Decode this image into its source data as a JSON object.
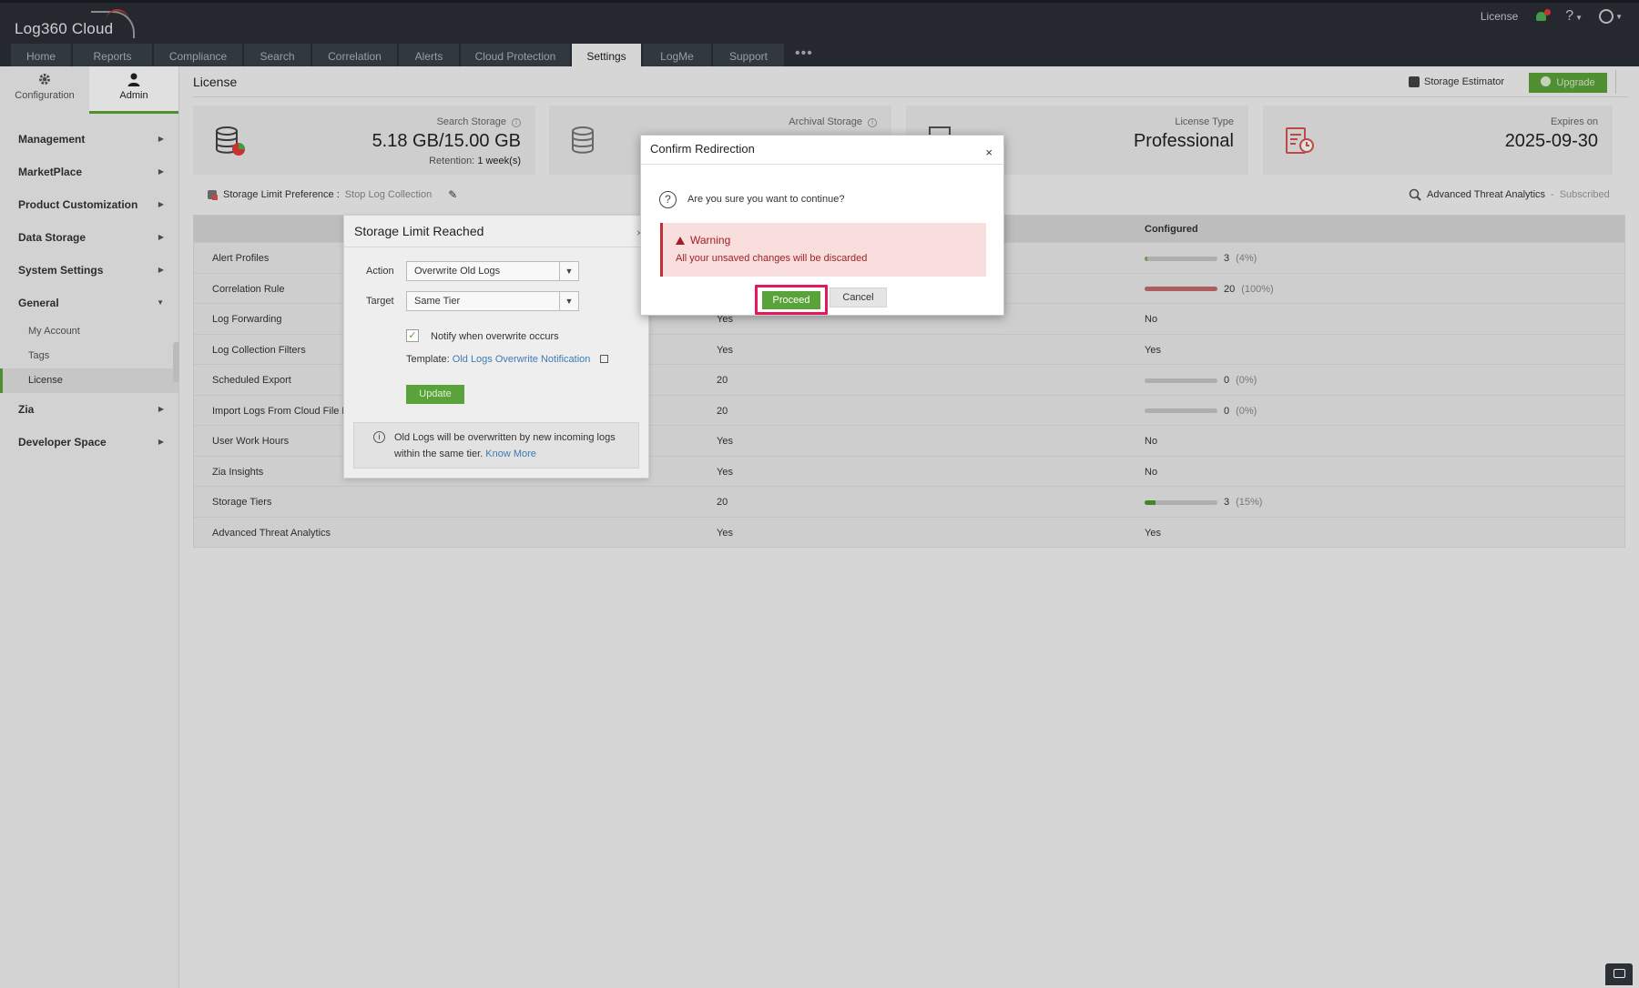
{
  "app": {
    "brand": "Log360 Cloud",
    "top_right": {
      "license_link": "License"
    }
  },
  "nav": {
    "tabs": [
      "Home",
      "Reports",
      "Compliance",
      "Search",
      "Correlation",
      "Alerts",
      "Cloud Protection",
      "Settings",
      "LogMe",
      "Support"
    ],
    "active_tab": "Settings",
    "more": "•••"
  },
  "sidebar": {
    "switch": [
      {
        "label": "Configuration",
        "icon": "gear-icon"
      },
      {
        "label": "Admin",
        "icon": "user-icon",
        "active": true
      }
    ],
    "items": [
      {
        "label": "Management"
      },
      {
        "label": "MarketPlace"
      },
      {
        "label": "Product Customization"
      },
      {
        "label": "Data Storage"
      },
      {
        "label": "System Settings"
      },
      {
        "label": "General",
        "expanded": true
      },
      {
        "label": "Zia"
      },
      {
        "label": "Developer Space"
      }
    ],
    "general_sub": [
      "My Account",
      "Tags",
      "License"
    ],
    "active_sub": "License"
  },
  "main": {
    "title": "License",
    "storage_estimator": "Storage Estimator",
    "upgrade": "Upgrade",
    "cards": {
      "search_storage": {
        "label": "Search Storage",
        "value": "5.18 GB/15.00 GB",
        "retention_label": "Retention:",
        "retention_value": "1 week(s)"
      },
      "archival_storage": {
        "label": "Archival Storage"
      },
      "license_type": {
        "label": "License Type",
        "value": "Professional"
      },
      "expires_on": {
        "label": "Expires on",
        "value": "2025-09-30"
      }
    },
    "storage_pref": {
      "label": "Storage Limit Preference :",
      "value": "Stop Log Collection"
    },
    "ata": {
      "label": "Advanced Threat Analytics",
      "sep": "-",
      "status": "Subscribed"
    },
    "table": {
      "col_configured": "Configured",
      "rows": [
        {
          "name": "Alert Profiles",
          "allowed": "",
          "configured": "3",
          "pct": "(4%)",
          "fraction": 0.04,
          "bar_color": "#7fae5a"
        },
        {
          "name": "Correlation Rule",
          "allowed": "",
          "configured": "20",
          "pct": "(100%)",
          "fraction": 1.0,
          "bar_color": "#c46a6a"
        },
        {
          "name": "Log Forwarding",
          "allowed": "Yes",
          "configured": "No"
        },
        {
          "name": "Log Collection Filters",
          "allowed": "Yes",
          "configured": "Yes"
        },
        {
          "name": "Scheduled Export",
          "allowed": "20",
          "configured": "0",
          "pct": "(0%)",
          "fraction": 0.0,
          "bar_color": "#7fae5a"
        },
        {
          "name": "Import Logs From Cloud File L",
          "allowed": "20",
          "configured": "0",
          "pct": "(0%)",
          "fraction": 0.0,
          "bar_color": "#7fae5a"
        },
        {
          "name": "User Work Hours",
          "allowed": "Yes",
          "configured": "No"
        },
        {
          "name": "Zia Insights",
          "allowed": "Yes",
          "configured": "No"
        },
        {
          "name": "Storage Tiers",
          "allowed": "20",
          "configured": "3",
          "pct": "(15%)",
          "fraction": 0.15,
          "bar_color": "#4c9a2a"
        },
        {
          "name": "Advanced Threat Analytics",
          "allowed": "Yes",
          "configured": "Yes"
        }
      ]
    }
  },
  "storage_popup": {
    "title": "Storage Limit Reached",
    "close": "×",
    "action_label": "Action",
    "action_value": "Overwrite Old Logs",
    "target_label": "Target",
    "target_value": "Same Tier",
    "notify_label": "Notify when overwrite occurs",
    "notify_checked": true,
    "template_label": "Template:",
    "template_link": "Old Logs Overwrite Notification",
    "update_label": "Update",
    "info_text": "Old Logs will be overwritten by new incoming logs within the same tier.",
    "know_more": "Know More"
  },
  "modal": {
    "title": "Confirm Redirection",
    "close": "×",
    "question": "Are you sure you want to continue?",
    "warning_title": "Warning",
    "warning_text": "All your unsaved changes will be discarded",
    "proceed": "Proceed",
    "cancel": "Cancel"
  },
  "colors": {
    "accent_green": "#5aa33a",
    "warning_red": "#a01f26",
    "highlight_pink": "#e5195a",
    "topbar": "#2b2f36"
  }
}
